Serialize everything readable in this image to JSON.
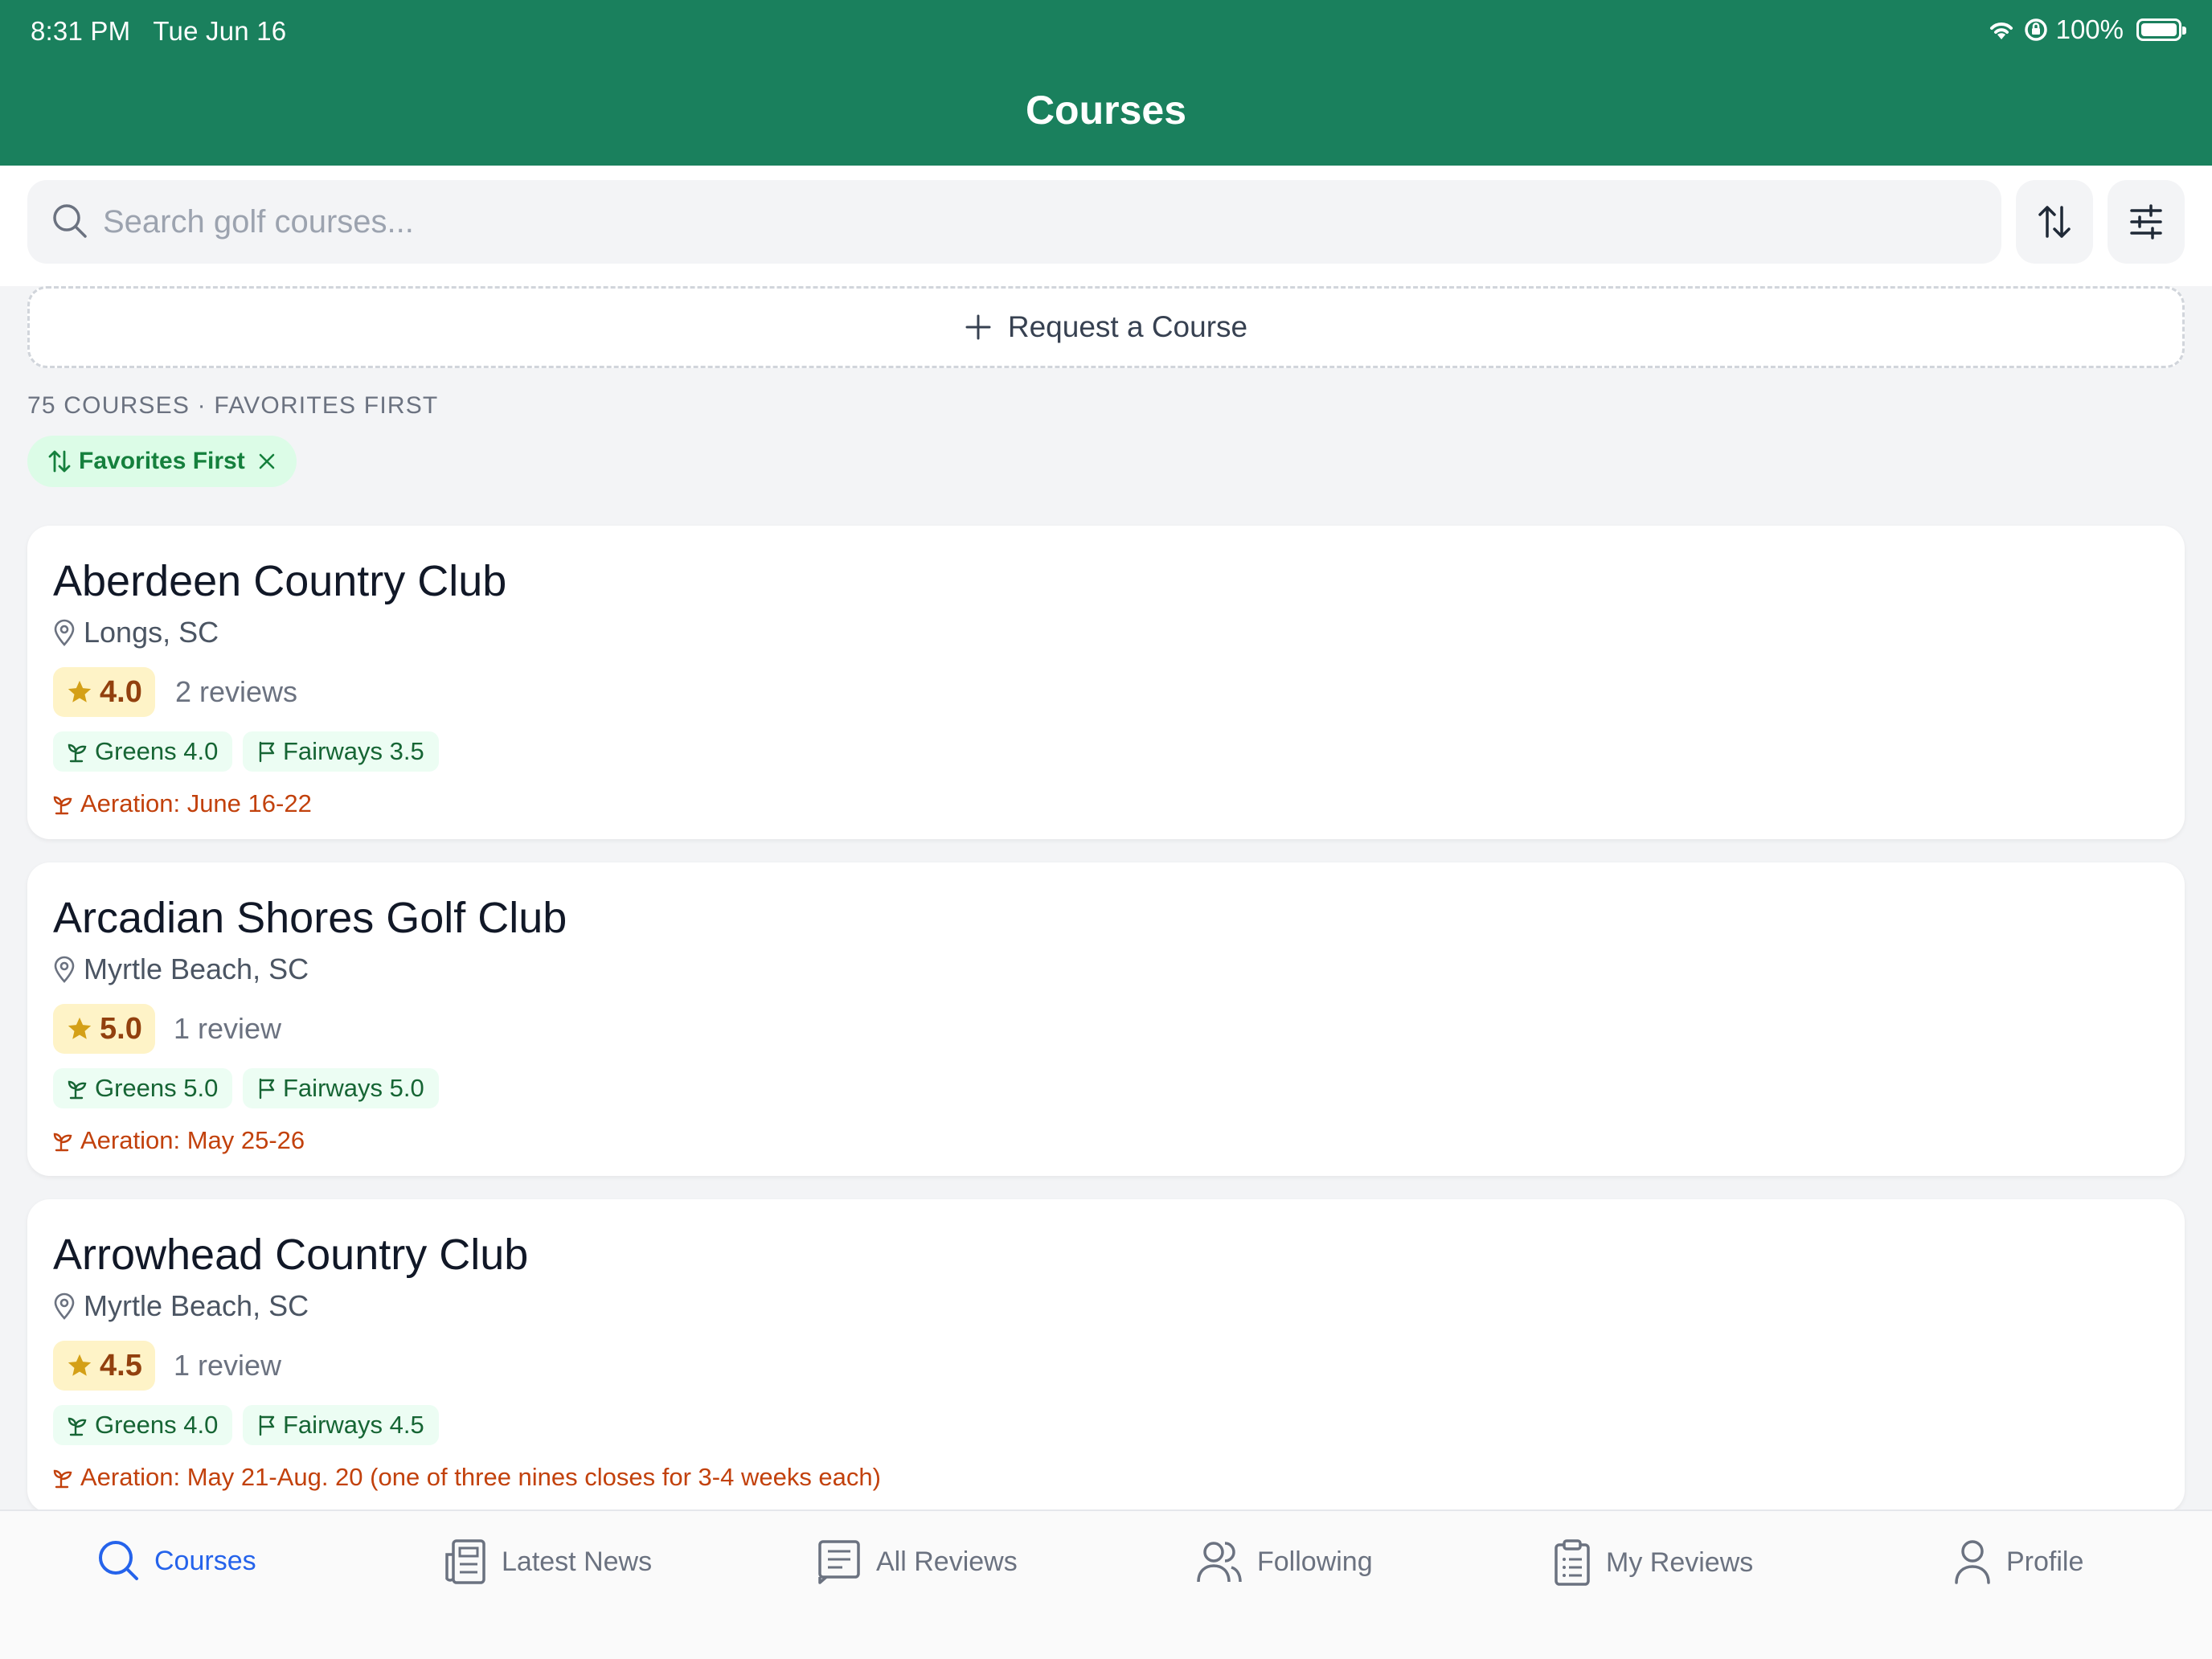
{
  "status_bar": {
    "time": "8:31 PM",
    "date": "Tue Jun 16",
    "battery": "100%"
  },
  "header": {
    "title": "Courses"
  },
  "search": {
    "placeholder": "Search golf courses..."
  },
  "request": {
    "label": "Request a Course"
  },
  "list_meta": {
    "count_label": "75 COURSES · FAVORITES FIRST"
  },
  "chip": {
    "label": "Favorites First"
  },
  "courses": [
    {
      "name": "Aberdeen Country Club",
      "location": "Longs, SC",
      "rating": "4.0",
      "reviews": "2 reviews",
      "greens": "Greens 4.0",
      "fairways": "Fairways 3.5",
      "aeration": "Aeration: June 16-22"
    },
    {
      "name": "Arcadian Shores Golf Club",
      "location": "Myrtle Beach, SC",
      "rating": "5.0",
      "reviews": "1 review",
      "greens": "Greens 5.0",
      "fairways": "Fairways 5.0",
      "aeration": "Aeration: May 25-26"
    },
    {
      "name": "Arrowhead Country Club",
      "location": "Myrtle Beach, SC",
      "rating": "4.5",
      "reviews": "1 review",
      "greens": "Greens 4.0",
      "fairways": "Fairways 4.5",
      "aeration": "Aeration: May 21-Aug. 20 (one of three nines closes for 3-4 weeks each)"
    }
  ],
  "tabs": [
    {
      "label": "Courses",
      "icon": "search-icon"
    },
    {
      "label": "Latest News",
      "icon": "newspaper-icon"
    },
    {
      "label": "All Reviews",
      "icon": "document-icon"
    },
    {
      "label": "Following",
      "icon": "users-icon"
    },
    {
      "label": "My Reviews",
      "icon": "clipboard-icon"
    },
    {
      "label": "Profile",
      "icon": "person-icon"
    }
  ],
  "colors": {
    "header": "#1a805d",
    "active_tab": "#2563eb",
    "aeration": "#c2410c",
    "rating_bg": "#fef3c7",
    "star": "#d4a017"
  }
}
